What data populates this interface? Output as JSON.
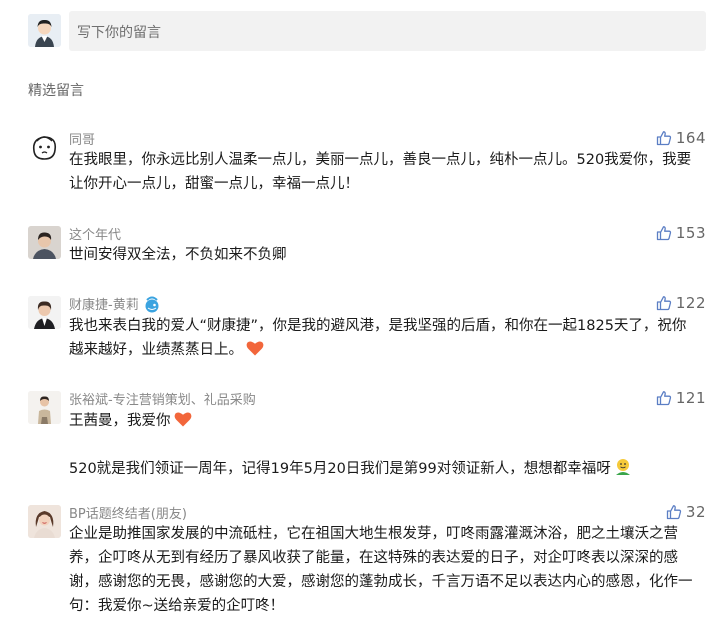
{
  "input": {
    "placeholder": "写下你的留言"
  },
  "section_title": "精选留言",
  "comments": [
    {
      "name": "同哥",
      "likes": "164",
      "paragraphs": [
        "在我眼里，你永远比别人温柔一点儿，美丽一点儿，善良一点儿，纯朴一点儿。520我爱你，我要让你开心一点儿，甜蜜一点儿，幸福一点儿！"
      ]
    },
    {
      "name": "这个年代",
      "likes": "153",
      "paragraphs": [
        "世间安得双全法，不负如来不负卿"
      ]
    },
    {
      "name": "财康捷-黄莉",
      "likes": "122",
      "paragraphs": [
        "我也来表白我的爱人“财康捷”，你是我的避风港，是我坚强的后盾，和你在一起1825天了，祝你越来越好，业绩蒸蒸日上。"
      ]
    },
    {
      "name": "张裕斌-专注营销策划、礼品采购",
      "likes": "121",
      "paragraphs": [
        "王茜曼，我爱你",
        "520就是我们领证一周年，记得19年5月20日我们是第99对领证新人，想想都幸福呀"
      ]
    },
    {
      "name": "BP话题终结者(朋友)",
      "likes": "32",
      "paragraphs": [
        "企业是助推国家发展的中流砥柱，它在祖国大地生根发芽，叮咚雨露灌溉沐浴，肥之土壤沃之营养，企叮咚从无到有经历了暴风收获了能量，在这特殊的表达爱的日子，对企叮咚表以深深的感谢，感谢您的无畏，感谢您的大爱，感谢您的蓬勃成长，千言万语不足以表达内心的感恩，化作一句：我爱你~送给亲爱的企叮咚！"
      ]
    }
  ],
  "colors": {
    "name": "#888888",
    "text": "#1a1a1a",
    "placeholder_bg": "#f2f2f2",
    "heart": "#f2663b"
  }
}
